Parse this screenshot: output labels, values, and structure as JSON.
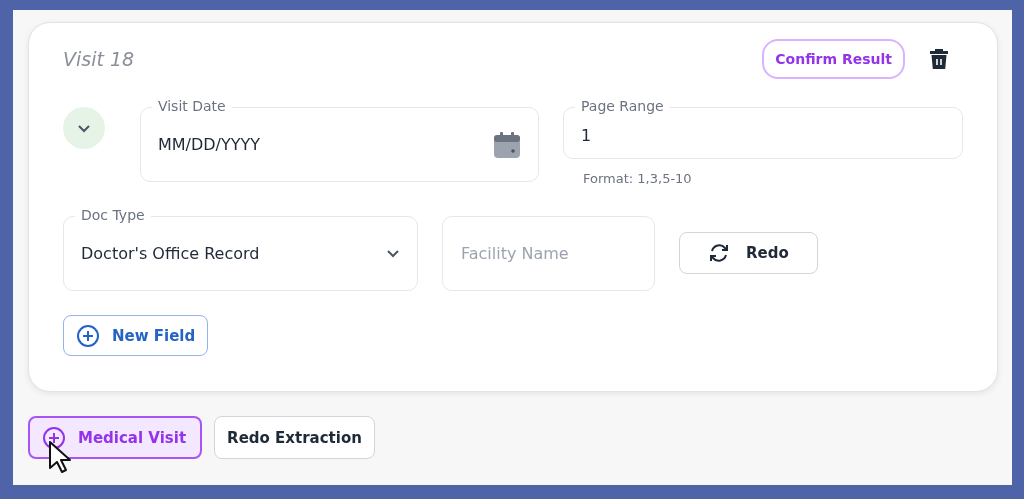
{
  "visit": {
    "title": "Visit 18",
    "confirm_button": "Confirm Result",
    "fields": [
      {
        "kind": "date",
        "label": "Visit Date",
        "value": "MM/DD/YYYY"
      },
      {
        "kind": "text",
        "label": "Page Range",
        "value": "1",
        "helper": "Format: 1,3,5-10"
      },
      {
        "kind": "select",
        "label": "Doc Type",
        "value": "Doctor's Office Record"
      },
      {
        "kind": "placeholder",
        "placeholder": "Facility Name"
      }
    ],
    "redo_button": "Redo",
    "new_field_button": "New Field"
  },
  "actions": [
    {
      "label": "Medical Visit",
      "kind": "add",
      "selected": true
    },
    {
      "label": "Redo Extraction",
      "kind": "plain",
      "selected": false
    }
  ]
}
